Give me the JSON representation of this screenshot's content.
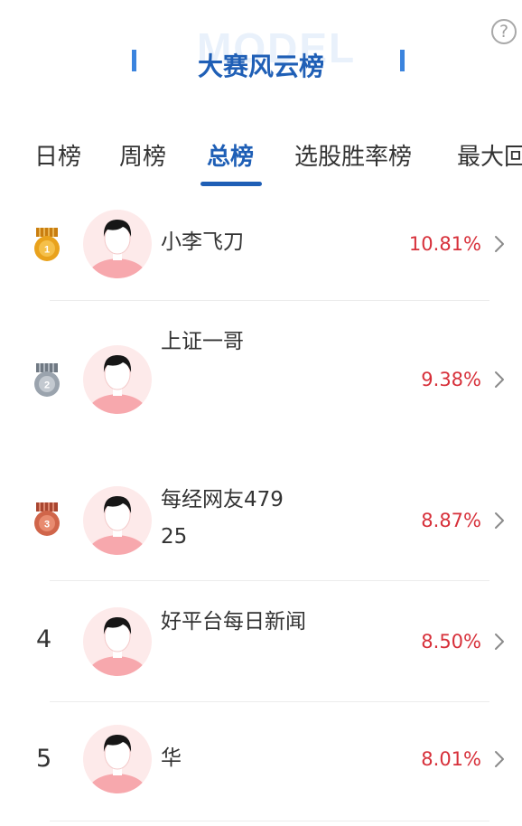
{
  "header": {
    "watermark": "MODEL",
    "title": "大赛风云榜",
    "help_glyph": "?"
  },
  "tabs": [
    {
      "label": "日榜",
      "active": false
    },
    {
      "label": "周榜",
      "active": false
    },
    {
      "label": "总榜",
      "active": true
    },
    {
      "label": "选股胜率榜",
      "active": false
    },
    {
      "label": "最大回",
      "active": false
    }
  ],
  "leaderboard": [
    {
      "rank": "1",
      "medal": "gold-medal",
      "name": "小李飞刀",
      "return": "10.81%"
    },
    {
      "rank": "2",
      "medal": "silver-medal",
      "name": "上证一哥",
      "return": "9.38%"
    },
    {
      "rank": "3",
      "medal": "bronze-medal",
      "name": "每经网友47925",
      "return": "8.87%"
    },
    {
      "rank": "4",
      "medal": "",
      "name": "好平台每日新闻",
      "return": "8.50%"
    },
    {
      "rank": "5",
      "medal": "",
      "name": "华",
      "return": "8.01%"
    }
  ],
  "colors": {
    "accent": "#1f5fb6",
    "return_red": "#d7303a",
    "gold": "#e9a21c",
    "silver": "#9aa3ad",
    "bronze": "#d0654a"
  }
}
